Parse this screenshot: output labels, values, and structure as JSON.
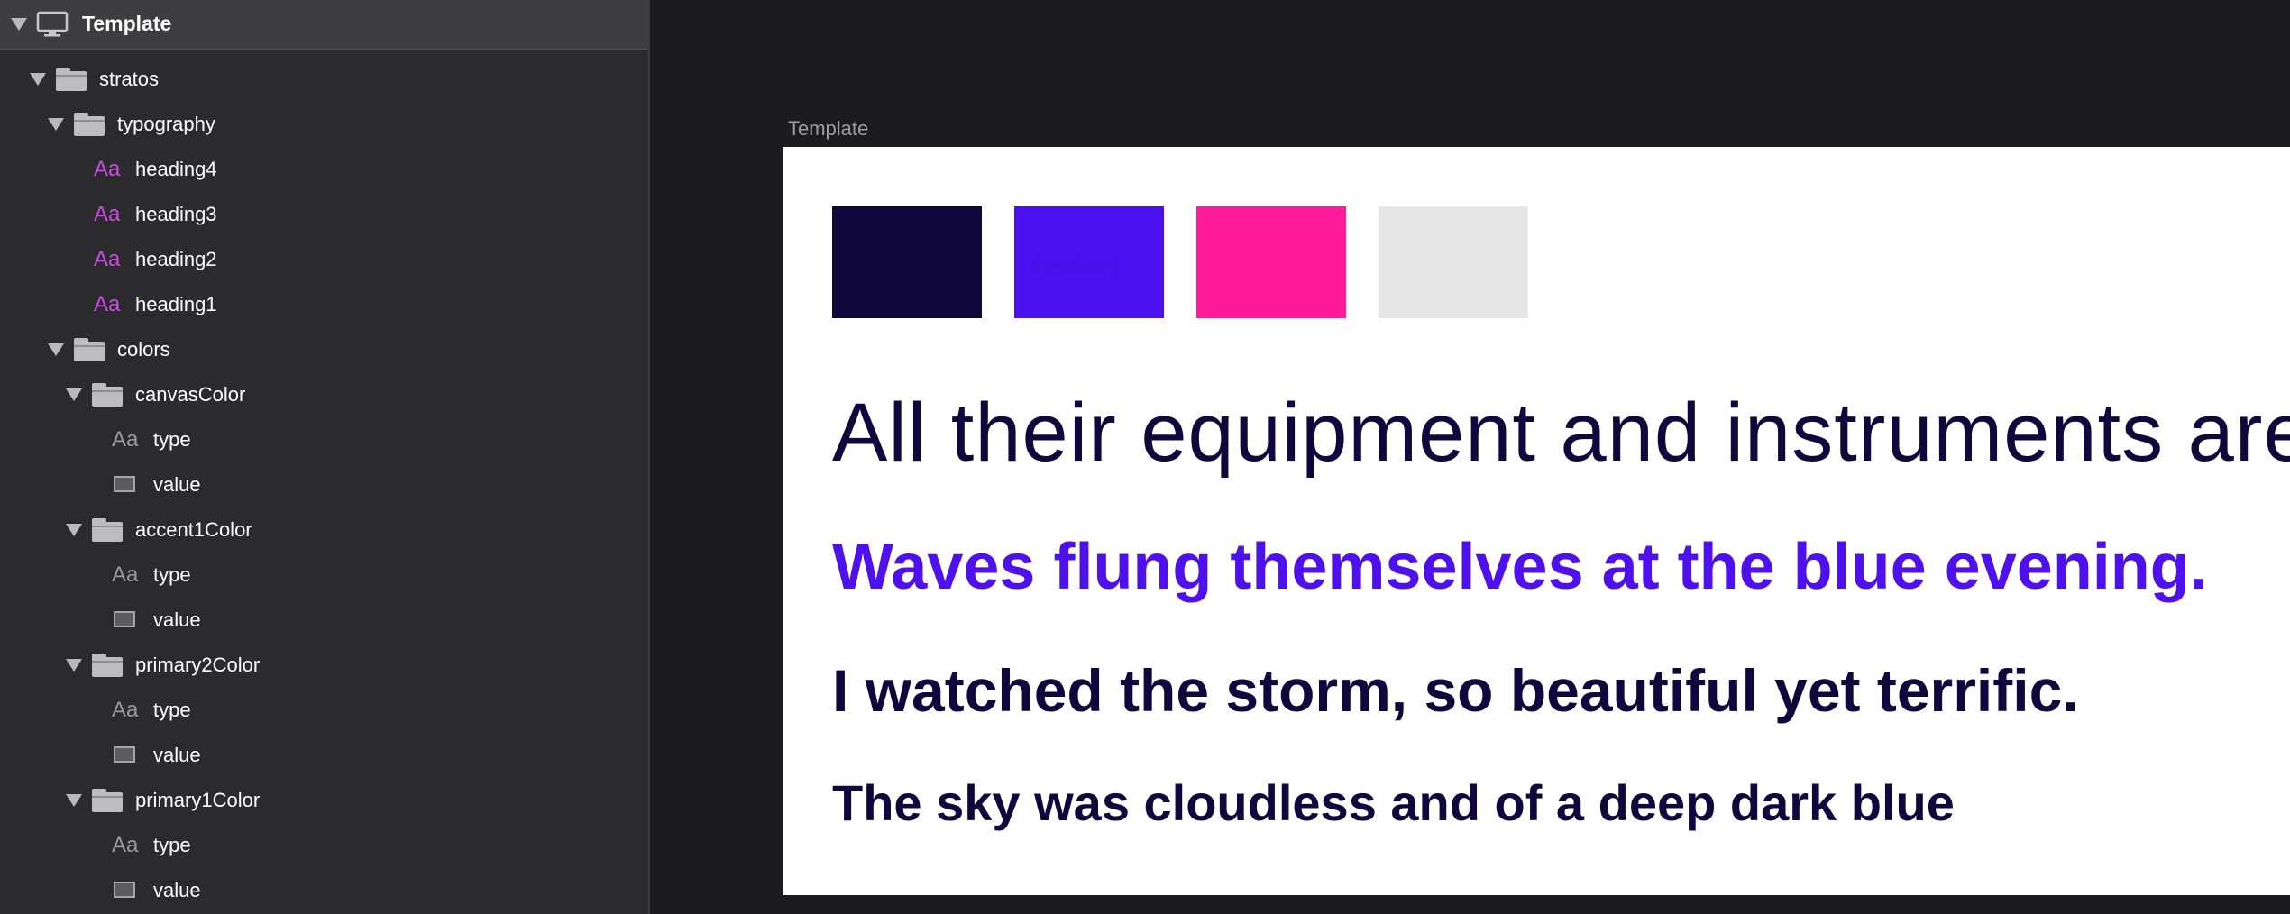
{
  "sidebar": {
    "header_title": "Template",
    "tree": [
      {
        "kind": "folder",
        "label": "stratos"
      },
      {
        "kind": "folder",
        "label": "typography"
      },
      {
        "kind": "text-style",
        "icon": "Aa",
        "label": "heading4"
      },
      {
        "kind": "text-style",
        "icon": "Aa",
        "label": "heading3"
      },
      {
        "kind": "text-style",
        "icon": "Aa",
        "label": "heading2"
      },
      {
        "kind": "text-style",
        "icon": "Aa",
        "label": "heading1"
      },
      {
        "kind": "folder",
        "label": "colors"
      },
      {
        "kind": "folder",
        "label": "canvasColor"
      },
      {
        "kind": "type",
        "icon": "Aa",
        "label": "type"
      },
      {
        "kind": "value",
        "label": "value"
      },
      {
        "kind": "folder",
        "label": "accent1Color"
      },
      {
        "kind": "type",
        "icon": "Aa",
        "label": "type"
      },
      {
        "kind": "value",
        "label": "value"
      },
      {
        "kind": "folder",
        "label": "primary2Color"
      },
      {
        "kind": "type",
        "icon": "Aa",
        "label": "type"
      },
      {
        "kind": "value",
        "label": "value"
      },
      {
        "kind": "folder",
        "label": "primary1Color"
      },
      {
        "kind": "type",
        "icon": "Aa",
        "label": "type"
      },
      {
        "kind": "value",
        "label": "value"
      }
    ]
  },
  "canvas": {
    "artboard_label": "Template",
    "color_swatches": [
      "#10073c",
      "#4a10f0",
      "#ff1a99",
      "#e6e6e6"
    ],
    "swatch_overlay_text": "{color}",
    "samples": {
      "heading1": "All their equipment and instruments are alive.",
      "heading2": "Waves flung themselves at the blue evening.",
      "heading3": "I watched the storm, so beautiful yet terrific.",
      "heading4": "The sky was cloudless and of a deep dark blue"
    }
  },
  "colors": {
    "panel_bg": "#2b2b2d",
    "header_bg": "#3e3e41",
    "canvas_bg": "#1c1c1e",
    "text_style_icon": "#c94be0",
    "navy": "#10073c",
    "violet": "#4f11eb",
    "pink": "#ff1a99"
  }
}
